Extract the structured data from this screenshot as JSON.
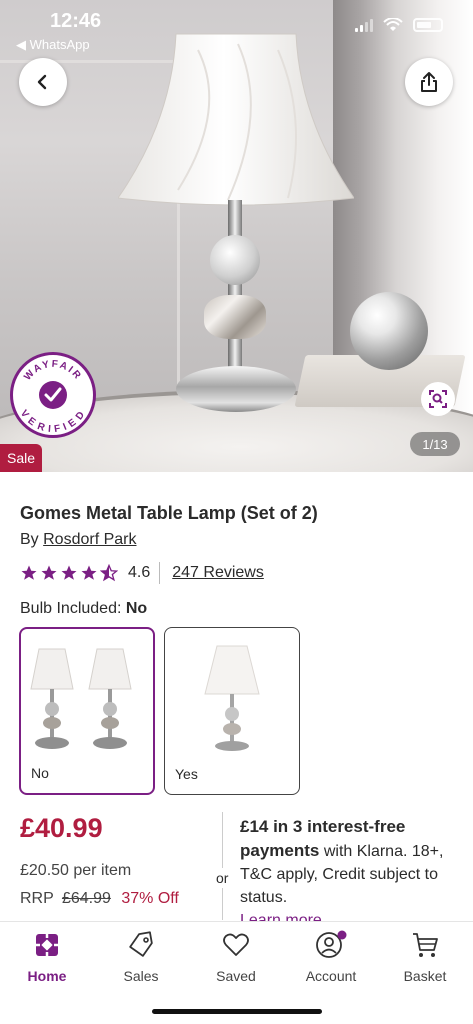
{
  "status_bar": {
    "time": "12:46",
    "back_app": "◀ WhatsApp"
  },
  "image": {
    "counter": "1/13",
    "sale_badge": "Sale",
    "verified_badge": {
      "top": "WAYFAIR",
      "bottom": "VERIFIED"
    }
  },
  "product": {
    "title": "Gomes Metal Table Lamp (Set of 2)",
    "by_prefix": "By",
    "brand": "Rosdorf Park",
    "rating": "4.6",
    "reviews": "247 Reviews"
  },
  "option": {
    "label": "Bulb Included:",
    "selected": "No",
    "choices": [
      {
        "label": "No",
        "selected": true
      },
      {
        "label": "Yes",
        "selected": false
      }
    ]
  },
  "pricing": {
    "price": "£40.99",
    "per_item": "£20.50 per item",
    "rrp_label": "RRP",
    "rrp_value": "£64.99",
    "discount": "37% Off",
    "or": "or",
    "klarna_bold": "£14 in 3 interest-free payments",
    "klarna_rest": "with Klarna. 18+, T&C apply, Credit subject to status.",
    "learn_more": "Learn more"
  },
  "tabbar": {
    "items": [
      {
        "label": "Home",
        "icon": "home-icon",
        "active": true
      },
      {
        "label": "Sales",
        "icon": "tag-icon",
        "active": false
      },
      {
        "label": "Saved",
        "icon": "heart-icon",
        "active": false
      },
      {
        "label": "Account",
        "icon": "account-icon",
        "active": false
      },
      {
        "label": "Basket",
        "icon": "basket-icon",
        "active": false
      }
    ]
  },
  "colors": {
    "brand_purple": "#7b1f84",
    "sale_red": "#b01d40"
  }
}
